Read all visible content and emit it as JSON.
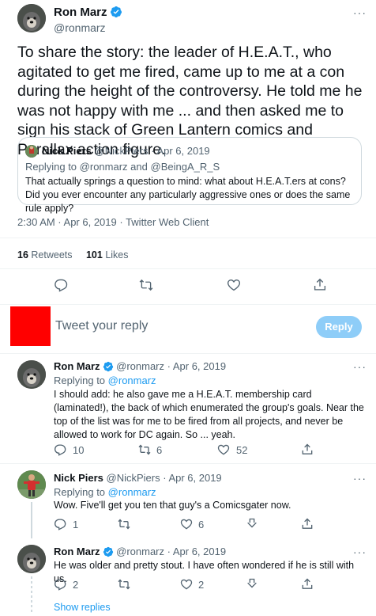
{
  "main_tweet": {
    "author_name": "Ron Marz",
    "author_handle": "@ronmarz",
    "text": "To share the story: the leader of H.E.A.T., who agitated to get me fired, came up to me at a con during the height of the controversy. He told me he was not happy with me ... and then asked me to sign his stack of Green Lantern comics and Parallax action figure.",
    "quoted": {
      "author_name": "Nick Piers",
      "author_handle": "@NickPiers",
      "date": "· Apr 6, 2019",
      "replying_label": "Replying to",
      "replying_to_1": "@ronmarz",
      "replying_and": "and",
      "replying_to_2": "@BeingA_R_S",
      "text": "That actually springs a question to mind: what about H.E.A.T.ers at cons? Did you ever encounter any particularly aggressive ones or does the same rule apply?"
    },
    "timestamp": "2:30 AM · Apr 6, 2019 · Twitter Web Client",
    "retweets_count": "16",
    "retweets_label": "Retweets",
    "likes_count": "101",
    "likes_label": "Likes"
  },
  "reply_box": {
    "placeholder": "Tweet your reply",
    "button_label": "Reply"
  },
  "replies": [
    {
      "author_name": "Ron Marz",
      "author_handle": "@ronmarz",
      "date": "· Apr 6, 2019",
      "replying_label": "Replying to",
      "replying_to": "@ronmarz",
      "text": "I should add: he also gave me a H.E.A.T. membership card (laminated!), the back of which enumerated the group's goals. Near the top of the list was for me to be fired from all projects, and never be allowed to work for DC again. So ... yeah.",
      "reply_count": "10",
      "retweet_count": "6",
      "like_count": "52"
    },
    {
      "author_name": "Nick Piers",
      "author_handle": "@NickPiers",
      "date": "· Apr 6, 2019",
      "replying_label": "Replying to",
      "replying_to": "@ronmarz",
      "text": "Wow. Five'll get you ten that guy's a Comicsgater now.",
      "reply_count": "1",
      "retweet_count": "",
      "like_count": "6"
    },
    {
      "author_name": "Ron Marz",
      "author_handle": "@ronmarz",
      "date": "· Apr 6, 2019",
      "text": "He was older and pretty stout. I have often wondered if he is still with us.",
      "reply_count": "2",
      "retweet_count": "",
      "like_count": "2"
    }
  ],
  "show_replies_label": "Show replies",
  "more_label": "···",
  "colors": {
    "accent": "#1d9bf0",
    "reply_button_disabled": "#8ecdf8",
    "composer_avatar": "#ff0000",
    "divider": "#eff3f4"
  }
}
